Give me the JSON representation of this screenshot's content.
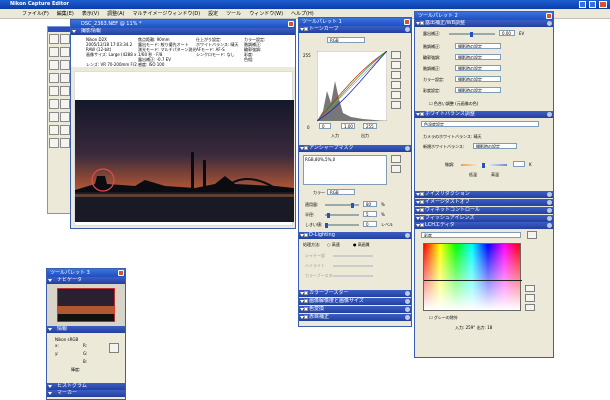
{
  "app": {
    "title": "Nikon Capture Editor",
    "menu": [
      "ファイル(F)",
      "編集(E)",
      "表示(V)",
      "調整(A)",
      "マルチイメージウィンドウ(D)",
      "設定",
      "ツール",
      "ウィンドウ(W)",
      "ヘルプ(H)"
    ]
  },
  "image_window": {
    "title": "DSC_2363.NEF @ 11% *",
    "tab": "撮影情報",
    "info": [
      [
        "Nikon D2X",
        "焦点距離: 90mm",
        "仕上がり設定: ",
        "カラー設定:"
      ],
      [
        "2005/12/18 17:03:34.2",
        "露出モード: 絞り優先オート",
        "ホワイトバランス: 晴天",
        "階調補正:"
      ],
      [
        "RAW (12-bit)",
        "測光モード: マルチパターン測光",
        "AFモード: AF-S",
        "輪郭強調:"
      ],
      [
        "画像サイズ: Large (4288 x 2848)",
        "1/60 秒 - F/8",
        "シンクロモード: なし",
        "彩度:"
      ],
      [
        "",
        "露出補正: -0.7 EV",
        "",
        "色相:"
      ],
      [
        "レンズ: VR 70-200mm F/2.8 G",
        "感度: ISO 100",
        "",
        ""
      ]
    ]
  },
  "palette1": {
    "title": "ツールパレット 1",
    "tone_curve": {
      "label": "トーンカーブ",
      "channel": "RGB",
      "max": "255",
      "in_min": "0",
      "in_gamma": "1.00",
      "in_max": "255",
      "input_label": "入力",
      "output_label": "出力"
    },
    "unsharp": {
      "label": "アンシャープマスク",
      "entry": "RGB,80%,5%,0",
      "color_label": "カラー",
      "color": "RGB",
      "amount_label": "適用量:",
      "amount": "80",
      "radius_label": "半径:",
      "radius": "5",
      "threshold_label": "しきい値:",
      "threshold": "0",
      "units": [
        "%",
        "%",
        "レベル"
      ]
    },
    "dlighting": {
      "label": "D-Lighting",
      "method_label": "処理方法:",
      "opt_low": "高速",
      "opt_high": "高画質",
      "rows": [
        "シャドー部",
        "ハイライト",
        "カラーブースター"
      ]
    },
    "collapsed": [
      "カラーブースター",
      "画像解像度と画像サイズ",
      "色変換",
      "赤目補正"
    ]
  },
  "palette2": {
    "title": "ツールパレット 2",
    "exposure": {
      "label": "露出補正/WB調整",
      "comp_label": "露出補正:",
      "comp_value": "0.00",
      "comp_unit": "EV"
    },
    "dropdown_rows": [
      {
        "label": "階調補正:",
        "value": "撮影時の設定"
      },
      {
        "label": "輪郭強調:",
        "value": "撮影時の設定"
      },
      {
        "label": "階調補正:",
        "value": "撮影時の設定"
      },
      {
        "label": "カラー設定:",
        "value": "撮影時の設定"
      },
      {
        "label": "彩度設定:",
        "value": "撮影時の設定"
      }
    ],
    "hue_label": "色合い調整 (元画像の色)",
    "wb": {
      "label": "ホワイトバランス調整",
      "mode": "色温度設定",
      "camera_label": "カメラのホワイトバランス:",
      "camera_value": "晴天",
      "new_label": "新規ホワイトバランス:",
      "new_value": "撮影時の設定",
      "fine_label": "微調:",
      "low": "低温",
      "high": "高温",
      "unit": "K"
    },
    "collapsed": [
      "ノイズリダクション",
      "イメージダストオフ",
      "ヴィネットコントロール",
      "フィッシュアイレンズ"
    ],
    "lch": {
      "label": "LCHエディタ",
      "channel": "彩度",
      "gray_label": "グレーの除外",
      "input_label": "入力:",
      "input_value": "259°",
      "output_label": "出力:",
      "output_value": "18"
    }
  },
  "palette3": {
    "title": "ツールパレット 3",
    "navigator": "ナビゲータ",
    "info_label": "情報",
    "profile": "Nikon sRGB",
    "rgb": [
      "R:",
      "G:",
      "B:"
    ],
    "xy": [
      "x:",
      "y:"
    ],
    "lum": "輝度:",
    "histogram": "ヒストグラム",
    "marker": "マーカー"
  },
  "colors": {
    "titlebar": "#0a3ea8",
    "section": "#2b47a8",
    "window_bg": "#ece9d8",
    "desktop": "#ffffff"
  }
}
